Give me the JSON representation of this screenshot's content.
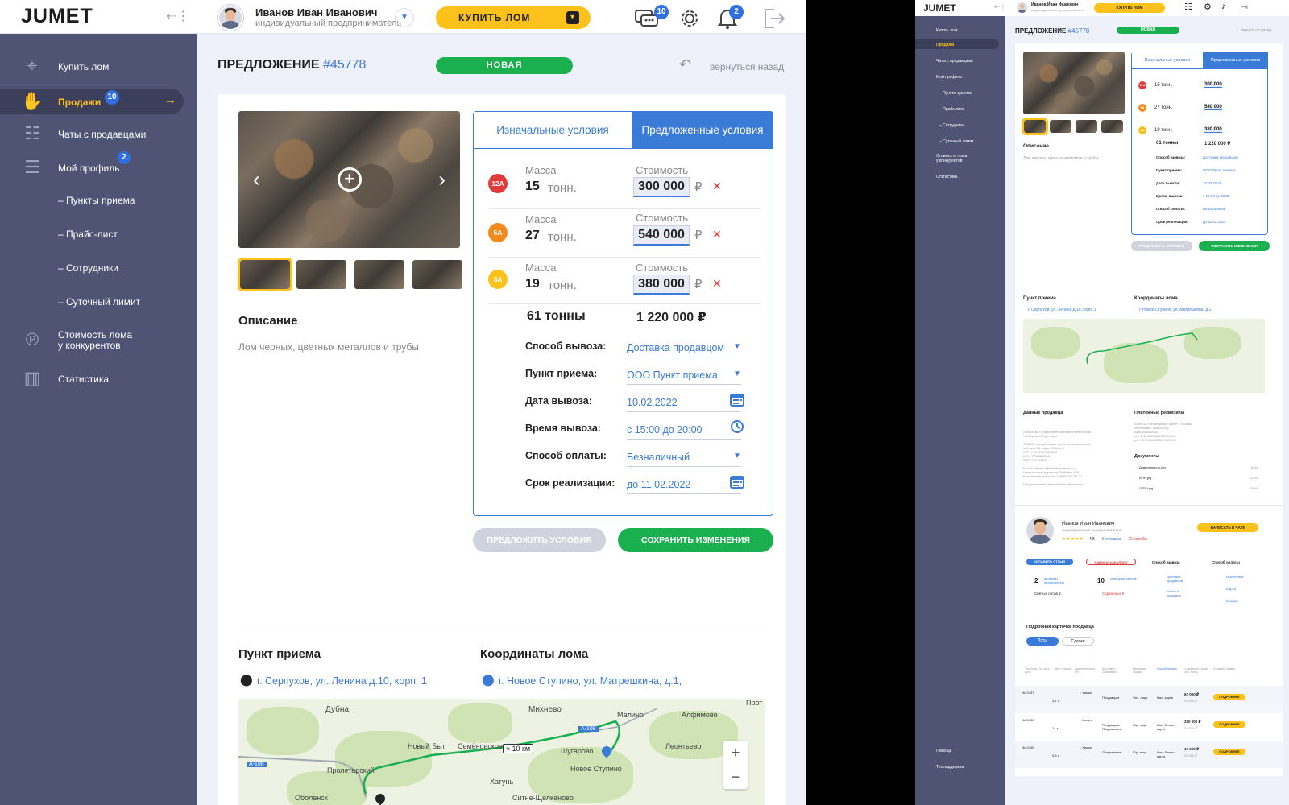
{
  "app": {
    "logo": "JUMET",
    "user_name": "Иванов Иван Иванович",
    "user_role": "индивидуальный предприниматель",
    "buy_button": "КУПИТЬ ЛОМ",
    "chat_badge": "10",
    "notif_badge": "2"
  },
  "sidebar": {
    "items": [
      {
        "label": "Купить лом",
        "icon": "location-pin-icon"
      },
      {
        "label": "Продажи",
        "icon": "handshake-icon",
        "badge": "10"
      },
      {
        "label": "Чаты с продавцами",
        "icon": "chat-icon"
      },
      {
        "label": "Мой профиль",
        "icon": "profile-icon",
        "badge": "2"
      },
      {
        "label": "Стоимость лома\nу конкурентов",
        "icon": "coin-icon"
      },
      {
        "label": "Статистика",
        "icon": "chart-icon"
      }
    ],
    "subitems": [
      "– Пункты приема",
      "– Прайс-лист",
      "– Сотрудники",
      "– Суточный лимит"
    ]
  },
  "offer": {
    "title_prefix": "ПРЕДЛОЖЕНИЕ",
    "title_number": "#45778",
    "status": "НОВАЯ",
    "back_link": "вернуться назад",
    "tab_initial": "Изначальные условия",
    "tab_proposed": "Предложенные условия",
    "description_title": "Описание",
    "description_text": "Лом черных, цветных металлов и трубы",
    "mass_label": "Масса",
    "cost_label": "Стоимость",
    "unit": "тонн.",
    "currency": "₽",
    "rows": [
      {
        "tag": "12А",
        "tag_color": "#e23a3a",
        "mass": "15",
        "price": "300 000"
      },
      {
        "tag": "5А",
        "tag_color": "#f28a1e",
        "mass": "27",
        "price": "540 000"
      },
      {
        "tag": "3А",
        "tag_color": "#fcc21b",
        "mass": "19",
        "price": "380 000"
      }
    ],
    "total_mass": "61 тонны",
    "total_price": "1 220 000 ₽",
    "fields": [
      {
        "label": "Способ вывоза:",
        "value": "Доставка продавцом",
        "icon": "chevron-down-icon"
      },
      {
        "label": "Пункт приема:",
        "value": "ООО Пункт приема",
        "icon": "chevron-down-icon"
      },
      {
        "label": "Дата вывоза:",
        "value": "10.02.2022",
        "icon": "calendar-icon"
      },
      {
        "label": "Время вывоза:",
        "value": "с 15:00 до 20:00",
        "icon": "clock-icon"
      },
      {
        "label": "Способ оплаты:",
        "value": "Безналичный",
        "icon": "chevron-down-icon"
      },
      {
        "label": "Срок реализации:",
        "value": "до 11.02.2022",
        "icon": "calendar-icon"
      }
    ],
    "btn_propose": "ПРЕДЛОЖИТЬ УСЛОВИЯ",
    "btn_save": "СОХРАНИТЬ ИЗМЕНЕНИЯ",
    "reception_title": "Пункт приема",
    "reception_address": "г. Серпухов, ул. Ленина д.10, корп. 1",
    "coords_title": "Координаты лома",
    "coords_address": "г. Новое Ступино, ул. Матрешкина, д.1,"
  },
  "map": {
    "places": [
      "Дубна",
      "Михнево",
      "Малино",
      "Алфимово",
      "Прот",
      "Новый Быт",
      "Семёновское",
      "Шугарово",
      "Леонтьево",
      "Пролетарский",
      "Новое Ступино",
      "Хатунь",
      "Оболенск",
      "Ситне-Щелканово"
    ],
    "road_a108": "А-108",
    "distance": "≈ 10 км",
    "zoom_in": "+",
    "zoom_out": "−"
  },
  "small": {
    "logo": "JUMET",
    "user_name": "Иванов Иван Иванович",
    "user_role": "индивидуальный предприниматель",
    "buy_button": "КУПИТЬ ЛОМ",
    "side_items": [
      "Купить лом",
      "Продажи",
      "Чаты с продавцами",
      "Мой профиль",
      "– Пункты приема",
      "– Прайс-лист",
      "– Сотрудники",
      "– Суточный лимит",
      "Стоимость лома\nу конкурентов",
      "Статистика"
    ],
    "side_bottom": [
      "Помощь",
      "Тех.поддержка"
    ],
    "title": "ПРЕДЛОЖЕНИЕ",
    "number": "#45778",
    "status": "НОВАЯ",
    "back": "вернуться назад",
    "tab_initial": "Изначальные условия",
    "tab_proposed": "Предложенные условия",
    "description_title": "Описание",
    "description_text": "Лом черных, цветных металлов и трубы",
    "rows": [
      {
        "tag": "12А",
        "mass": "15 тонн.",
        "price": "300 000"
      },
      {
        "tag": "5А",
        "mass": "27 тонн.",
        "price": "540 000"
      },
      {
        "tag": "3А",
        "mass": "19 тонн.",
        "price": "380 000"
      }
    ],
    "total_mass": "61 тонны",
    "total_price": "1 220 000 ₽",
    "fields": [
      {
        "label": "Способ вывоза:",
        "value": "Доставка продавцом"
      },
      {
        "label": "Пункт приема:",
        "value": "ООО Пункт приема"
      },
      {
        "label": "Дата вывоза:",
        "value": "10.02.2022"
      },
      {
        "label": "Время вывоза:",
        "value": "с 15:00 до 20:00"
      },
      {
        "label": "Способ оплаты:",
        "value": "Безналичный"
      },
      {
        "label": "Срок реализации:",
        "value": "до 11.02.2022"
      }
    ],
    "btn_propose": "ПРЕДЛОЖИТЬ УСЛОВИЯ",
    "btn_save": "СОХРАНИТЬ ИЗМЕНЕНИЯ",
    "reception_title": "Пункт приема",
    "reception_address": "г. Серпухов, ул. Ленина д.10, корп. 1",
    "coords_title": "Координаты лома",
    "coords_address": "г. Новое Ступино, ул. Матрешкина, д.1,",
    "seller_data_title": "Данные продавца",
    "seller_data_lines": [
      "Общество с ограниченной ответственностью",
      "«Лебедев и Партнеры»",
      "",
      "123290, город Москва, тупик Магистральный",
      "1-й, дом 5А, офис 2504, к.8",
      "ОГРН: 1127747034060",
      "ИНН: 7714886663",
      "КПП: 771401001",
      "",
      "E-mail: lebedev@lebedevpartners.ru",
      "Генеральный директор: Лебедев О.В.",
      "Контактный телефон: +7(985)762-67-31",
      "",
      "Представитель: Иванов Иван Иванович"
    ],
    "payment_title": "Платежные реквизиты",
    "payment_lines": [
      "Банк: АО «ЮниКредит Банк» г. Москва",
      "ИНН банка: 355453436",
      "БИК: 044525545",
      "к/с: 30101810300000000545",
      "р/с: 40702810620010002399"
    ],
    "documents_title": "Документы",
    "documents": [
      {
        "name": "Доверенность.jpg",
        "size": "10 Кб"
      },
      {
        "name": "ИНН.jpg",
        "size": "20 Кб"
      },
      {
        "name": "ОГРН.jpg",
        "size": "20 Кб"
      }
    ],
    "seller_name": "Иванов Иван Иванович",
    "seller_role": "индивидуальный предприниматель",
    "rating": "4,5",
    "reviews": "5 отзывов",
    "complaints": "2 жалобы",
    "write_chat": "НАПИСАТЬ В ЧАТЕ",
    "leave_review": "ОСТАВИТЬ ОТЗЫВ",
    "write_complaint": "НАПИСАТЬ ЖАЛОБУ",
    "active_count": "2",
    "active_label": "активных предложения",
    "removed_lots": "Снятых лотов 2",
    "deals_count": "10",
    "deals_label": "успешных сделок",
    "failed_deals": "Сорванных 9",
    "export_title": "Способ вывоза",
    "export_options": [
      "Доставка продавцом",
      "Вывоз от продавца"
    ],
    "pay_title": "Способ оплаты",
    "pay_options": [
      "Наличные",
      "Карта",
      "Безнал"
    ],
    "card_title": "Подробная карточка продавца",
    "tab_lots": "Лоты",
    "tab_deals": "Сделки",
    "table_headers": [
      "Тип лома / № лота, дата",
      "Вес / Масса",
      "Удаленность от ПП",
      "Доставка / Самовывоз",
      "Правовая форма",
      "Способ оплаты",
      "Стоимость / Цена за 1 тонну",
      "Оставить заявку"
    ],
    "table_rows": [
      {
        "id": "№12457",
        "date": "13.02.2022",
        "mass": "3,1 т.",
        "city": "г. Химки",
        "dist": "≈ 10 км от ПП",
        "delivery": "Продавцом",
        "legal": "Физ. лицо",
        "pay": "Нал, карта",
        "price": "62 000 ₽",
        "per_ton": "20 000 ₽"
      },
      {
        "id": "№12456",
        "date": "11.02.2022",
        "mass": "14 т.",
        "city": "г. Калуга",
        "dist": "≈ 265 км от ПП",
        "delivery": "Продавцом, Покупателем",
        "legal": "Юр. лицо",
        "pay": "Нал, безнал карта",
        "price": "280 000 ₽",
        "per_ton": "20 000 ₽"
      },
      {
        "id": "№12455",
        "date": "10.02.2022",
        "mass": "0,5 т.",
        "city": "г. Химки",
        "dist": "≈ 10 км от ПП",
        "delivery": "Покупателем",
        "legal": "Юр. лицо",
        "pay": "Нал, безнал карта",
        "price": "10 000 ₽",
        "per_ton": "20 000 ₽"
      }
    ],
    "details_button": "ПОДРОБНЕЕ"
  },
  "colors": {
    "accent": "#3b7bd8",
    "yellow": "#fcc21b",
    "green": "#1bb04f",
    "sidebar": "#4f5474",
    "danger": "#e23a3a"
  }
}
